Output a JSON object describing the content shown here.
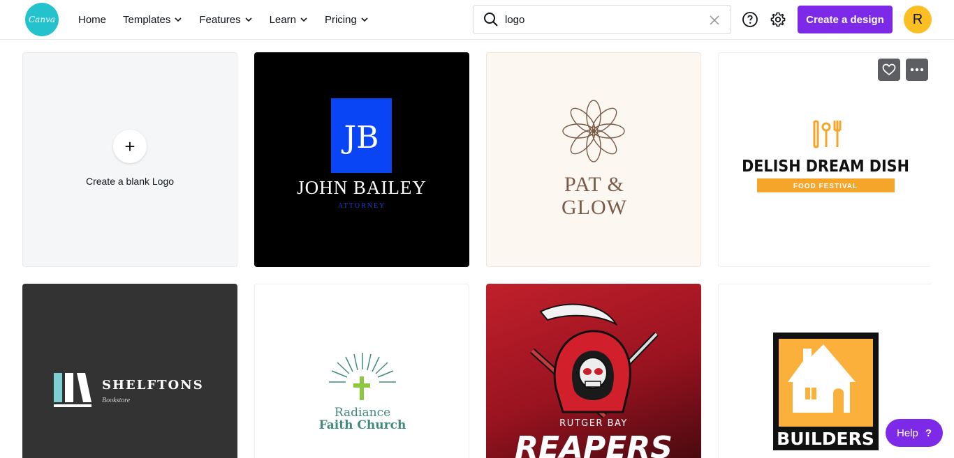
{
  "brand": {
    "logo_text": "Canva",
    "accent": "#7d2ae8",
    "logo_color": "#24c2cc"
  },
  "nav": {
    "items": [
      {
        "label": "Home",
        "has_dropdown": false
      },
      {
        "label": "Templates",
        "has_dropdown": true
      },
      {
        "label": "Features",
        "has_dropdown": true
      },
      {
        "label": "Learn",
        "has_dropdown": true
      },
      {
        "label": "Pricing",
        "has_dropdown": true
      }
    ]
  },
  "search": {
    "value": "logo",
    "icon": "search-icon",
    "clear_icon": "close-icon"
  },
  "header_actions": {
    "help_icon": "question-circle-icon",
    "settings_icon": "gear-icon",
    "create_label": "Create a design",
    "avatar_initial": "R"
  },
  "blank_card": {
    "label": "Create a blank Logo",
    "icon": "plus-icon"
  },
  "templates": [
    {
      "name": "john-bailey",
      "monogram": "JB",
      "title": "JOHN BAILEY",
      "subtitle": "ATTORNEY"
    },
    {
      "name": "pat-glow",
      "line1": "PAT &",
      "line2": "GLOW"
    },
    {
      "name": "delish-dream-dish",
      "title": "DELISH DREAM DISH",
      "subtitle": "FOOD FESTIVAL",
      "actions": [
        "heart-icon",
        "more-icon"
      ]
    },
    {
      "name": "shelftons",
      "title": "SHELFTONS",
      "subtitle": "Bookstore"
    },
    {
      "name": "radiance",
      "line1": "Radiance",
      "line2": "Faith Church"
    },
    {
      "name": "rutger-bay",
      "line1": "RUTGER BAY",
      "line2": "REAPERS"
    },
    {
      "name": "builders",
      "title": "BUILDERS"
    }
  ],
  "help": {
    "label": "Help",
    "icon": "?"
  }
}
